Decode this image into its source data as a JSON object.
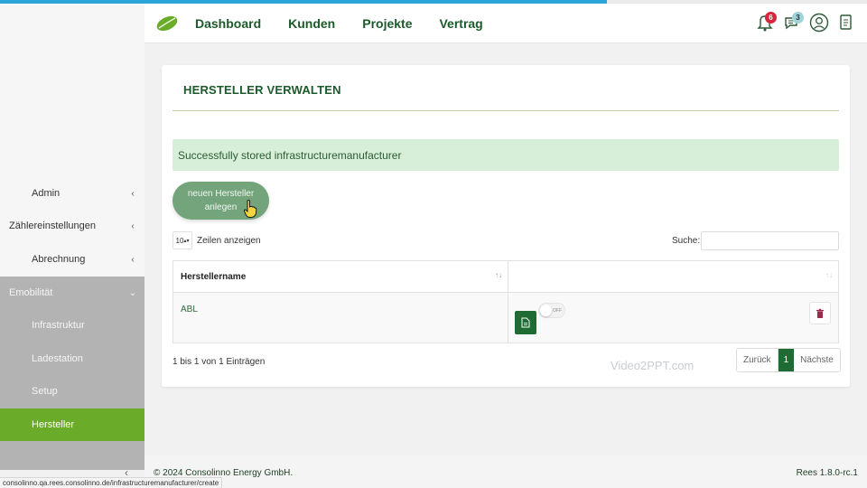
{
  "colors": {
    "brand_green": "#1c5a2c",
    "active_green": "#6aab2a",
    "progress_blue": "#2aa7d8"
  },
  "progress": {
    "fraction": 0.7
  },
  "nav": {
    "dashboard": "Dashboard",
    "kunden": "Kunden",
    "projekte": "Projekte",
    "vertrag": "Vertrag"
  },
  "header": {
    "notifications_count": "6",
    "messages_count": "3"
  },
  "sidebar": {
    "admin": "Admin",
    "zaehler": "Zählereinstellungen",
    "abrechnung": "Abrechnung",
    "emobilitaet": "Emobilität",
    "infrastruktur": "Infrastruktur",
    "ladestation": "Ladestation",
    "setup": "Setup",
    "hersteller": "Hersteller"
  },
  "page": {
    "title": "HERSTELLER VERWALTEN",
    "alert": "Successfully stored infrastructuremanufacturer",
    "create_line1": "neuen Hersteller",
    "create_line2": "anlegen",
    "length_value": "10",
    "length_label": "Zeilen anzeigen",
    "search_label": "Suche:",
    "search_value": "",
    "table": {
      "col_name": "Herstellername",
      "col_actions": "",
      "rows": [
        {
          "name": "ABL",
          "toggle": "OFF"
        }
      ]
    },
    "info": "1 bis 1 von 1 Einträgen",
    "pager": {
      "prev": "Zurück",
      "current": "1",
      "next": "Nächste"
    },
    "watermark": "Video2PPT.com"
  },
  "footer": {
    "copyright": "© 2024 Consolinno Energy GmbH.",
    "version": "Rees 1.8.0-rc.1",
    "status_url": "consolinno.qa.rees.consolinno.de/infrastructuremanufacturer/create"
  }
}
